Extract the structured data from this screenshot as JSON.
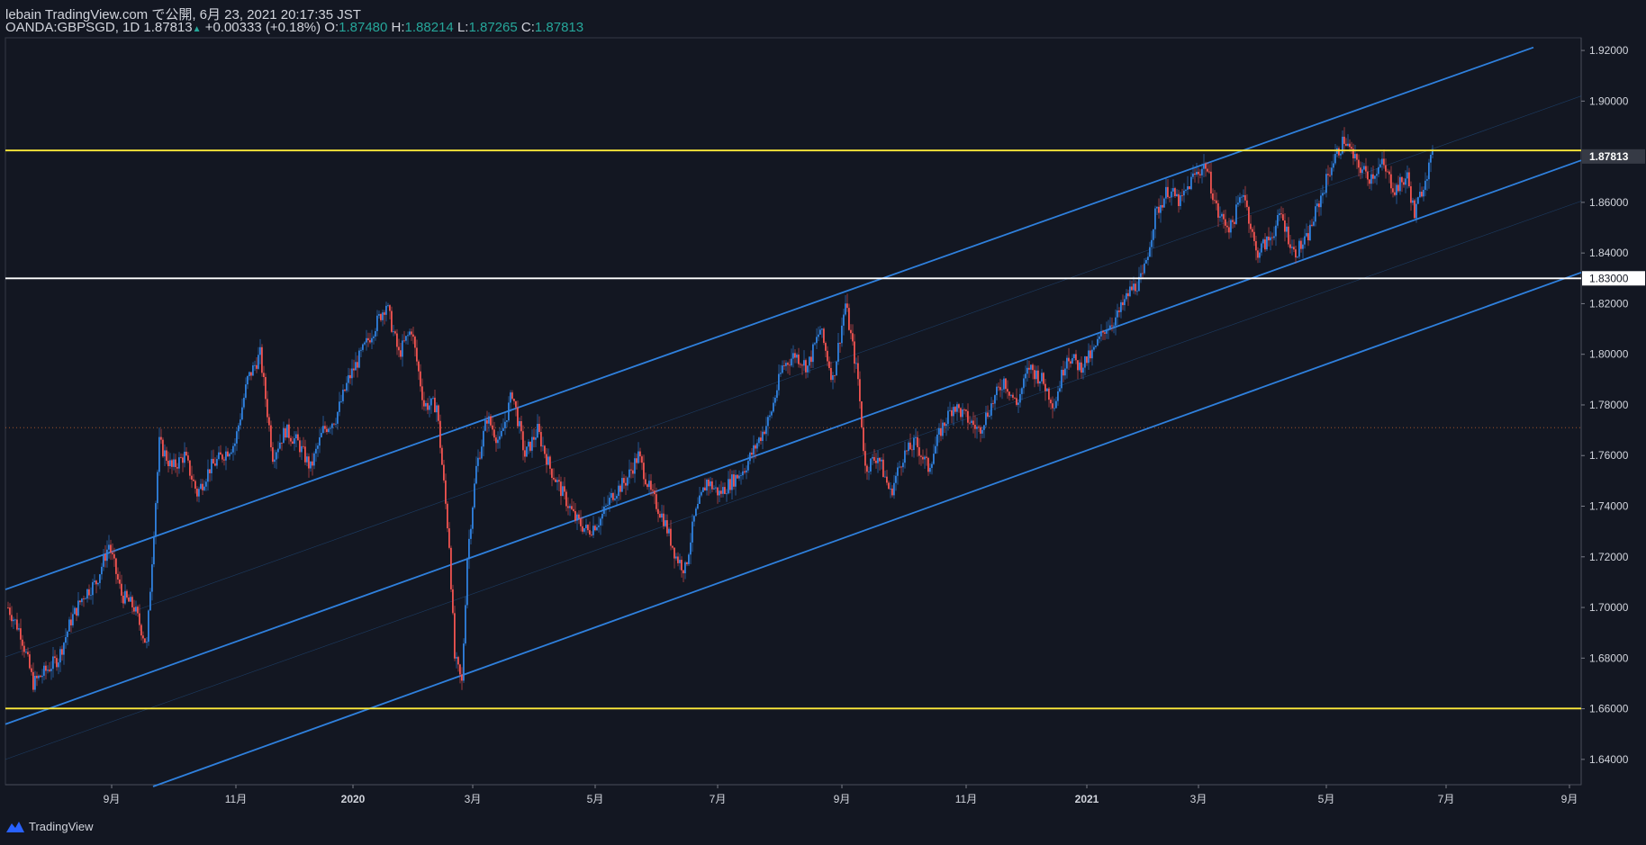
{
  "header": {
    "line1": "lebain TradingView.com で公開, 6月 23, 2021 20:17:35 JST",
    "symbol": "OANDA:GBPSGD, 1D",
    "last": "1.87813",
    "change": "+0.00333 (+0.18%)",
    "o_label": "O:",
    "o": "1.87480",
    "h_label": "H:",
    "h": "1.88214",
    "l_label": "L:",
    "l": "1.87265",
    "c_label": "C:",
    "c": "1.87813"
  },
  "footer": {
    "brand": "TradingView"
  },
  "colors": {
    "background": "#131722",
    "up": "#2f80dd",
    "down": "#ef5350",
    "channel": "#2f80dd",
    "yellow": "#ffeb3b",
    "white": "#ffffff",
    "axis_text": "#d1d4dc"
  },
  "chart_data": {
    "type": "candlestick",
    "symbol": "OANDA:GBPSGD",
    "timeframe": "1D",
    "x_ticks": [
      "9月",
      "11月",
      "2020",
      "3月",
      "5月",
      "7月",
      "9月",
      "11月",
      "2021",
      "3月",
      "5月",
      "7月",
      "9月"
    ],
    "y_ticks": [
      "1.64000",
      "1.66000",
      "1.68000",
      "1.70000",
      "1.72000",
      "1.74000",
      "1.76000",
      "1.78000",
      "1.80000",
      "1.82000",
      "1.84000",
      "1.86000",
      "1.90000",
      "1.92000"
    ],
    "ylim": [
      1.63,
      1.925
    ],
    "last_price_label": "1.87813",
    "horizontal_levels": [
      {
        "value": 1.8805,
        "color": "yellow"
      },
      {
        "value": 1.83,
        "color": "white",
        "label": "1.83000"
      },
      {
        "value": 1.6601,
        "color": "yellow"
      }
    ],
    "close_anchors": [
      [
        0,
        1.7
      ],
      [
        7,
        1.69
      ],
      [
        14,
        1.67
      ],
      [
        21,
        1.675
      ],
      [
        28,
        1.68
      ],
      [
        35,
        1.695
      ],
      [
        42,
        1.705
      ],
      [
        49,
        1.71
      ],
      [
        56,
        1.725
      ],
      [
        63,
        1.705
      ],
      [
        70,
        1.7
      ],
      [
        77,
        1.685
      ],
      [
        84,
        1.765
      ],
      [
        91,
        1.755
      ],
      [
        98,
        1.76
      ],
      [
        105,
        1.745
      ],
      [
        112,
        1.755
      ],
      [
        119,
        1.76
      ],
      [
        126,
        1.765
      ],
      [
        133,
        1.79
      ],
      [
        140,
        1.8
      ],
      [
        147,
        1.76
      ],
      [
        154,
        1.77
      ],
      [
        161,
        1.765
      ],
      [
        168,
        1.755
      ],
      [
        175,
        1.77
      ],
      [
        182,
        1.775
      ],
      [
        189,
        1.79
      ],
      [
        196,
        1.8
      ],
      [
        203,
        1.81
      ],
      [
        210,
        1.82
      ],
      [
        217,
        1.8
      ],
      [
        224,
        1.81
      ],
      [
        231,
        1.78
      ],
      [
        238,
        1.78
      ],
      [
        245,
        1.725
      ],
      [
        248,
        1.68
      ],
      [
        252,
        1.67
      ],
      [
        255,
        1.72
      ],
      [
        260,
        1.755
      ],
      [
        266,
        1.775
      ],
      [
        273,
        1.765
      ],
      [
        280,
        1.785
      ],
      [
        287,
        1.76
      ],
      [
        294,
        1.77
      ],
      [
        301,
        1.755
      ],
      [
        308,
        1.745
      ],
      [
        315,
        1.735
      ],
      [
        322,
        1.73
      ],
      [
        329,
        1.735
      ],
      [
        336,
        1.745
      ],
      [
        343,
        1.75
      ],
      [
        350,
        1.76
      ],
      [
        357,
        1.745
      ],
      [
        364,
        1.735
      ],
      [
        371,
        1.72
      ],
      [
        376,
        1.715
      ],
      [
        381,
        1.735
      ],
      [
        388,
        1.75
      ],
      [
        395,
        1.745
      ],
      [
        402,
        1.75
      ],
      [
        409,
        1.755
      ],
      [
        416,
        1.765
      ],
      [
        423,
        1.775
      ],
      [
        430,
        1.795
      ],
      [
        437,
        1.8
      ],
      [
        444,
        1.795
      ],
      [
        451,
        1.81
      ],
      [
        458,
        1.79
      ],
      [
        465,
        1.82
      ],
      [
        472,
        1.79
      ],
      [
        476,
        1.755
      ],
      [
        483,
        1.76
      ],
      [
        490,
        1.745
      ],
      [
        497,
        1.76
      ],
      [
        504,
        1.765
      ],
      [
        511,
        1.755
      ],
      [
        518,
        1.77
      ],
      [
        525,
        1.78
      ],
      [
        532,
        1.775
      ],
      [
        539,
        1.77
      ],
      [
        546,
        1.78
      ],
      [
        553,
        1.79
      ],
      [
        560,
        1.78
      ],
      [
        567,
        1.795
      ],
      [
        574,
        1.79
      ],
      [
        581,
        1.78
      ],
      [
        588,
        1.8
      ],
      [
        595,
        1.795
      ],
      [
        602,
        1.8
      ],
      [
        609,
        1.81
      ],
      [
        616,
        1.815
      ],
      [
        623,
        1.825
      ],
      [
        630,
        1.83
      ],
      [
        637,
        1.855
      ],
      [
        644,
        1.865
      ],
      [
        651,
        1.86
      ],
      [
        658,
        1.87
      ],
      [
        665,
        1.875
      ],
      [
        672,
        1.855
      ],
      [
        679,
        1.85
      ],
      [
        686,
        1.865
      ],
      [
        693,
        1.84
      ],
      [
        700,
        1.845
      ],
      [
        707,
        1.855
      ],
      [
        714,
        1.84
      ],
      [
        721,
        1.845
      ],
      [
        728,
        1.86
      ],
      [
        735,
        1.875
      ],
      [
        742,
        1.885
      ],
      [
        749,
        1.875
      ],
      [
        756,
        1.87
      ],
      [
        763,
        1.875
      ],
      [
        770,
        1.865
      ],
      [
        777,
        1.87
      ],
      [
        781,
        1.855
      ],
      [
        787,
        1.87
      ],
      [
        791,
        1.878
      ]
    ]
  }
}
